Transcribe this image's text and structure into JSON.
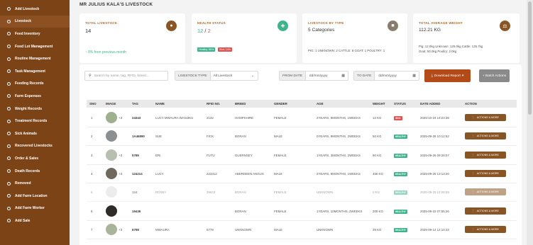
{
  "sidebar": {
    "items": [
      {
        "label": "Add Livestock",
        "icon": "plus-circle-icon"
      },
      {
        "label": "Livestock",
        "icon": "livestock-icon"
      },
      {
        "label": "Feed Inventory",
        "icon": "inventory-icon"
      },
      {
        "label": "Food Lot Management",
        "icon": "lot-icon"
      },
      {
        "label": "Routine Management",
        "icon": "routine-icon"
      },
      {
        "label": "Task Management",
        "icon": "task-icon"
      },
      {
        "label": "Feeding Records",
        "icon": "feeding-icon"
      },
      {
        "label": "Farm Expenses",
        "icon": "expenses-icon"
      },
      {
        "label": "Weight Records",
        "icon": "weight-chart-icon"
      },
      {
        "label": "Treatment Records",
        "icon": "treatment-icon"
      },
      {
        "label": "Sick Animals",
        "icon": "medical-plus-icon"
      },
      {
        "label": "Recovered Livestocks",
        "icon": "recovered-icon"
      },
      {
        "label": "Order & Sales",
        "icon": "cart-icon"
      },
      {
        "label": "Death Records",
        "icon": "death-icon"
      },
      {
        "label": "Removed",
        "icon": "removed-icon"
      },
      {
        "label": "Add Farm Location",
        "icon": "location-icon"
      },
      {
        "label": "Add Farm Worker",
        "icon": "worker-icon"
      },
      {
        "label": "Add Sale",
        "icon": "sale-icon"
      }
    ]
  },
  "page": {
    "title": "MR JULIUS KALA'S LIVESTOCK"
  },
  "cards": {
    "total": {
      "label": "TOTAL LIVESTOCK",
      "value": "14",
      "change": "0% from previous month",
      "trend": "↑"
    },
    "health": {
      "label": "HEALTH STATUS",
      "healthy": "12",
      "sep": " / ",
      "sick": "2",
      "healthy_badge": "Healthy: 86%",
      "sick_badge": "Sick: 14%"
    },
    "type": {
      "label": "LIVESTOCK BY TYPE",
      "value": "5 Categories",
      "detail": "PIG: 1  UNKNOWN: 2  CATTLE: 8  GOAT: 1  POULTRY: 1"
    },
    "weight": {
      "label": "TOTAL AVERAGE WEIGHT",
      "value": "112.21 KG",
      "line1": "Pig: 12.0kg  Unknown: 125.0kg  Cattle: 135.7kg",
      "line2": "Goat: 50.0kg  Poultry: 2.0kg"
    }
  },
  "filters": {
    "search_placeholder": "Search by name, tag, RFID, breed...",
    "type_label": "LIVESTOCK TYPE",
    "type_value": "All Livestock",
    "from_label": "FROM DATE",
    "to_label": "TO DATE",
    "date_placeholder": "dd/mm/yyyy",
    "download_label": "Download Report",
    "batch_label": "+ Batch Actions"
  },
  "table": {
    "headers": [
      "SNO",
      "IMAGE",
      "TAG",
      "NAME",
      "RFID NO.",
      "BREED",
      "GENDER",
      "AGE",
      "WEIGHT",
      "STATUS",
      "DATE ADDED",
      "ACTION"
    ],
    "action_label": "ACTIONS & MORE",
    "rows": [
      {
        "sno": "1",
        "img_extra": "+3",
        "tag": "24343",
        "name": "LUCY MWAURA WANJIKU",
        "rfid": "2132",
        "breed": "HAMPSHIRE",
        "gender": "FEMALE",
        "age": "2YEARS, 9MONTHS, 1WEEKS",
        "weight": "12 KG",
        "status": "SICK",
        "date": "2025-10-24 14:23:38",
        "faded": false
      },
      {
        "sno": "2",
        "img_extra": "",
        "tag": "1A46890",
        "name": "SUE",
        "rfid": "FICK",
        "breed": "BORAN",
        "gender": "MALE",
        "age": "0YEARS, 9MONTHS, 2WEEKS",
        "weight": "50 KG",
        "status": "HEALTHY",
        "date": "2025-09-28 10:12:52",
        "faded": false
      },
      {
        "sno": "3",
        "img_extra": "+3",
        "tag": "5789",
        "name": "ERI",
        "rfid": "FUTU",
        "breed": "GUERNSEY",
        "gender": "FEMALE",
        "age": "1YEARS, 3MONTHS, 2WEEKS",
        "weight": "90 KG",
        "status": "HEALTHY",
        "date": "2025-09-26 09:26:07",
        "faded": false
      },
      {
        "sno": "4",
        "img_extra": "+3",
        "tag": "124214",
        "name": "LUCY",
        "rfid": "223312",
        "breed": "ABERDEEN ANGUS",
        "gender": "MALE",
        "age": "2YEARS, 9MONTHS, 1WEEKS",
        "weight": "456 KG",
        "status": "HEALTHY",
        "date": "2025-09-25 13:13:20",
        "faded": false
      },
      {
        "sno": "5",
        "img_extra": "",
        "tag": "124",
        "name": "ROSEY",
        "rfid": "35623",
        "breed": "BORAN",
        "gender": "FEMALE",
        "age": "UNKNOWN",
        "weight": "0 KG",
        "status": "HEALTHY",
        "date": "2025-09-19 14:08:59",
        "faded": true
      },
      {
        "sno": "6",
        "img_extra": "",
        "tag": "19436",
        "name": "",
        "rfid": "",
        "breed": "BORAN",
        "gender": "FEMALE",
        "age": "1YEARS, 10MONTHS, 2WEEKS",
        "weight": "200 KG",
        "status": "HEALTHY",
        "date": "2025-09-22 07:55:26",
        "faded": false
      },
      {
        "sno": "7",
        "img_extra": "+3",
        "tag": "6798",
        "name": "MWAURA",
        "rfid": "6778",
        "breed": "UNKNOWN",
        "gender": "MALE",
        "age": "UNKNOWN",
        "weight": "39 KG",
        "status": "HEALTHY",
        "date": "2025-09-14 12:10:33",
        "faded": false
      }
    ]
  },
  "colors": {
    "brand": "#7b4316",
    "accent": "#b36a2a",
    "healthy": "#3bb58a",
    "sick": "#e0524f",
    "action": "#8a5524",
    "download": "#b34a17"
  }
}
